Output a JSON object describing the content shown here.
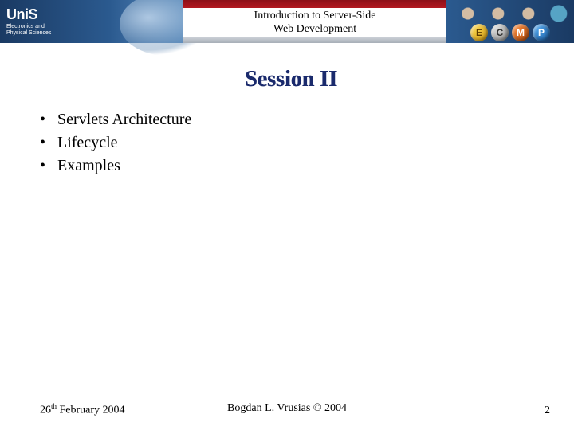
{
  "banner": {
    "logo_main": "UniS",
    "logo_sub1": "Electronics and",
    "logo_sub2": "Physical Sciences",
    "title_line1": "Introduction to Server-Side",
    "title_line2": "Web Development",
    "badges": {
      "e": "E",
      "c": "C",
      "m": "M",
      "p": "P"
    }
  },
  "slide": {
    "heading": "Session II",
    "bullets": [
      "Servlets Architecture",
      "Lifecycle",
      "Examples"
    ]
  },
  "footer": {
    "date_day": "26",
    "date_suffix": "th",
    "date_rest": " February 2004",
    "author": "Bogdan L. Vrusias © 2004",
    "page": "2"
  }
}
